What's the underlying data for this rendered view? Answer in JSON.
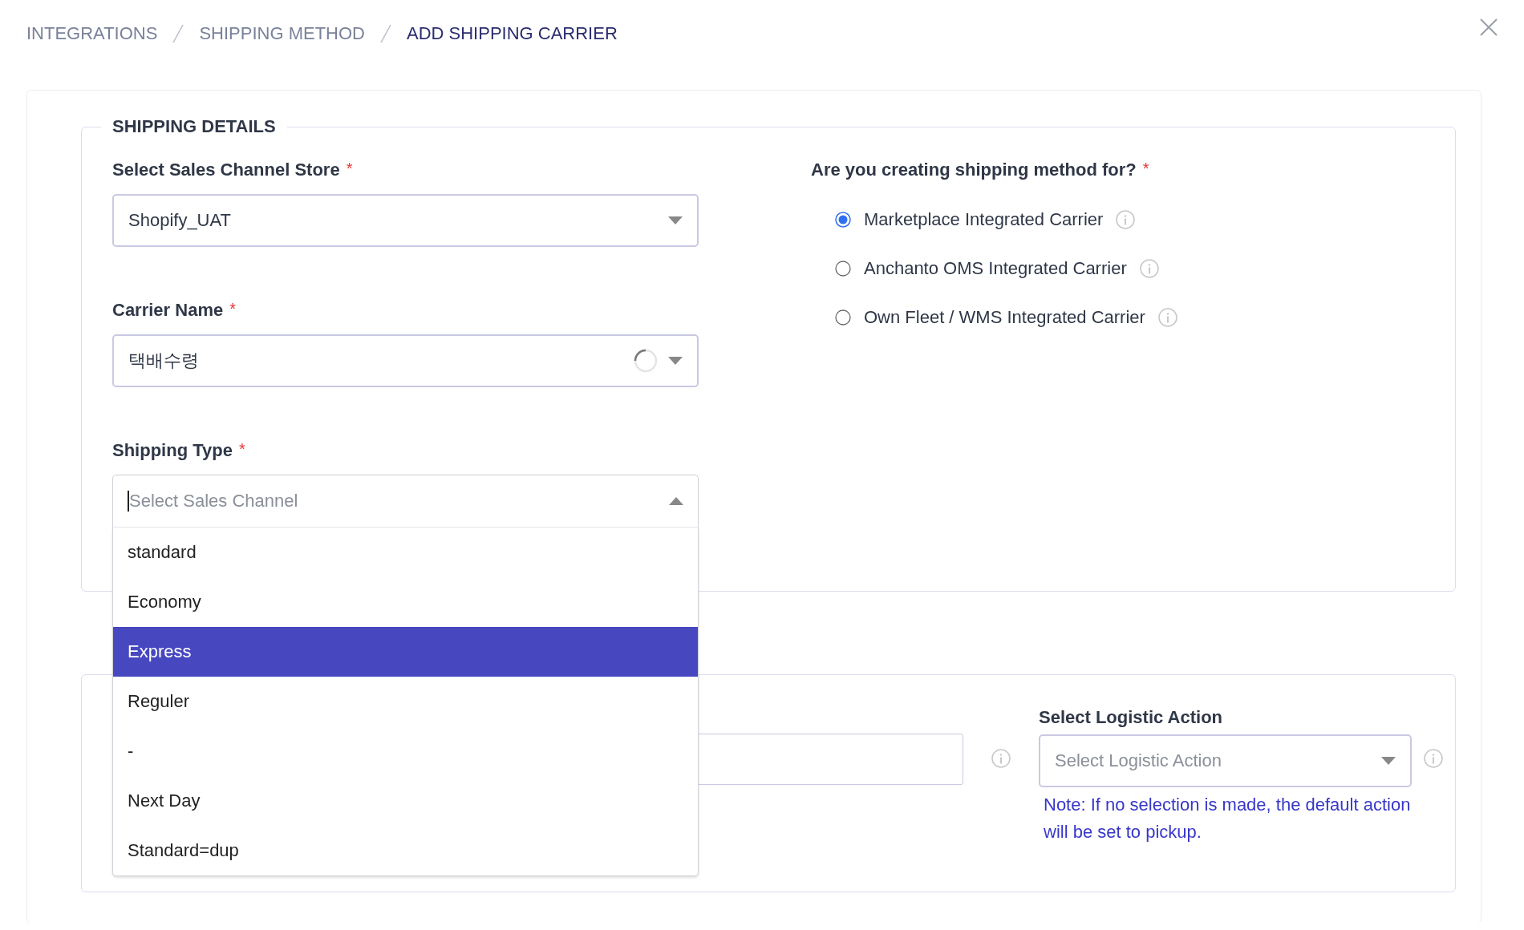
{
  "breadcrumb": [
    {
      "label": "INTEGRATIONS",
      "current": false
    },
    {
      "label": "SHIPPING METHOD",
      "current": false
    },
    {
      "label": "ADD SHIPPING CARRIER",
      "current": true
    }
  ],
  "shipping_details": {
    "legend": "SHIPPING DETAILS",
    "sales_channel_store": {
      "label": "Select Sales Channel Store",
      "required_mark": "*",
      "value": "Shopify_UAT"
    },
    "carrier_name": {
      "label": "Carrier Name",
      "required_mark": "*",
      "value": "택배수령",
      "loading": true
    },
    "shipping_type": {
      "label": "Shipping Type",
      "required_mark": "*",
      "placeholder": "Select Sales Channel",
      "expanded": true,
      "options": [
        {
          "label": "standard",
          "selected": false
        },
        {
          "label": "Economy",
          "selected": false
        },
        {
          "label": "Express",
          "selected": true
        },
        {
          "label": "Reguler",
          "selected": false
        },
        {
          "label": "-",
          "selected": false
        },
        {
          "label": "Next Day",
          "selected": false
        },
        {
          "label": "Standard=dup",
          "selected": false
        }
      ]
    },
    "method_for": {
      "label": "Are you creating shipping method for?",
      "required_mark": "*",
      "options": [
        {
          "label": "Marketplace Integrated Carrier",
          "selected": true
        },
        {
          "label": "Anchanto OMS Integrated Carrier",
          "selected": false
        },
        {
          "label": "Own Fleet / WMS Integrated Carrier",
          "selected": false
        }
      ]
    }
  },
  "logistics": {
    "logistic_action": {
      "label": "Select Logistic Action",
      "placeholder": "Select Logistic Action",
      "note": "Note: If no selection is made, the default action will be set to pickup."
    }
  }
}
